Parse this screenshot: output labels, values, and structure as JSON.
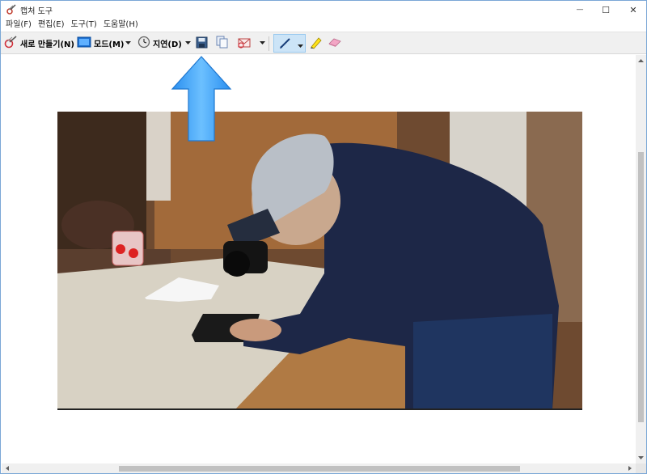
{
  "window": {
    "title": "캡처 도구",
    "minimize_glyph": "—",
    "maximize_glyph": "☐",
    "close_glyph": "✕"
  },
  "menu": [
    "파일(F)",
    "편집(E)",
    "도구(T)",
    "도움말(H)"
  ],
  "toolbar": {
    "new_label": "새로 만들기(N)",
    "mode_label": "모드(M)",
    "delay_label": "지연(D)",
    "icons": [
      "new-snip-icon",
      "mode-icon",
      "clock-icon",
      "save-icon",
      "copy-icon",
      "send-email-icon",
      "pen-icon",
      "highlighter-icon",
      "eraser-icon"
    ]
  },
  "annotation": {
    "icon": "blue-up-arrow-icon",
    "color": "#3d9df0"
  },
  "colors": {
    "selected_tool_bg": "#cce4f7",
    "accent": "#0078d7"
  }
}
